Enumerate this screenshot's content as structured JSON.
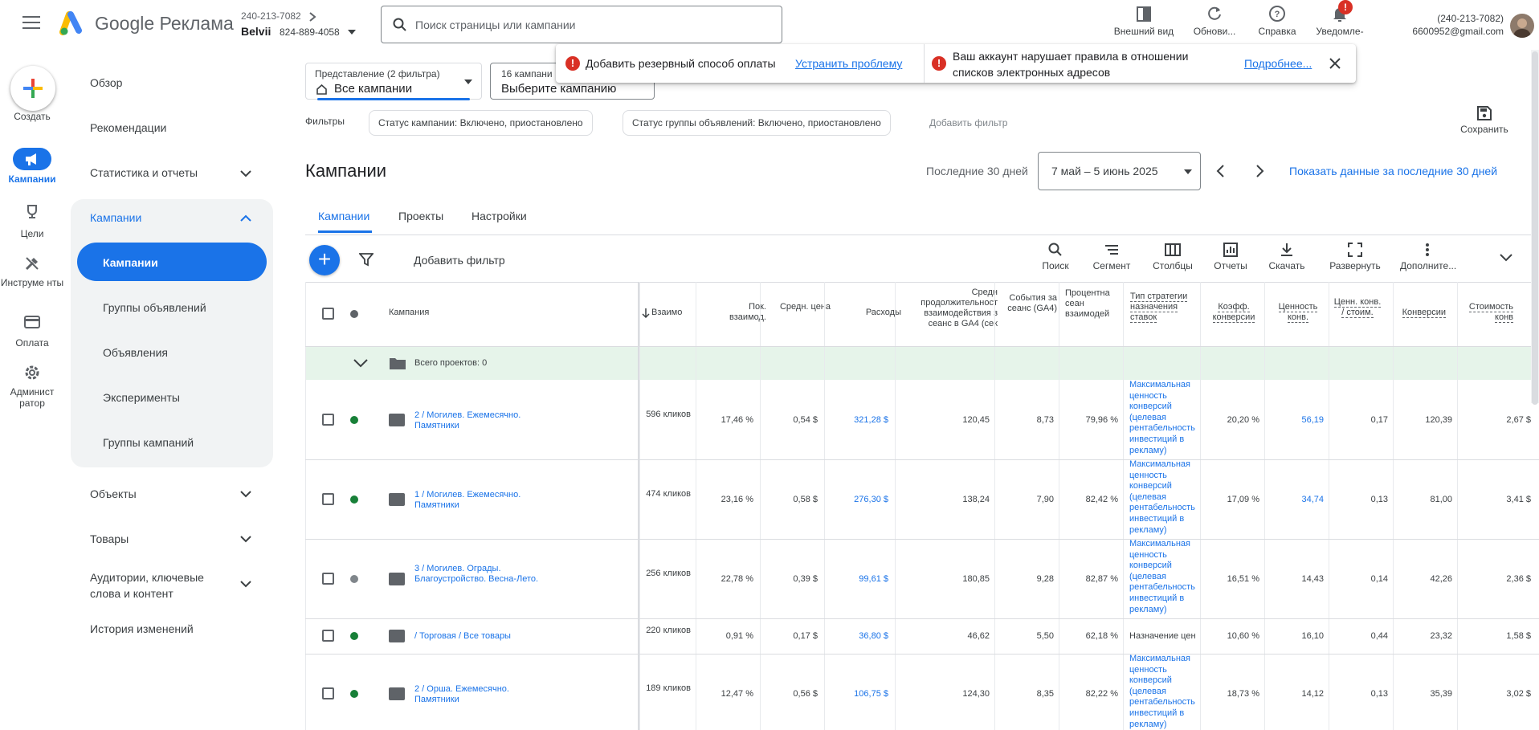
{
  "app": {
    "brand": "Google Реклама",
    "account_id": "240-213-7082",
    "account_name": "Belvii",
    "account_number": "824-889-4058",
    "search_placeholder": "Поиск страницы или кампании"
  },
  "topbar": {
    "items": [
      {
        "label": "Внешний вид",
        "icon": "appearance-icon"
      },
      {
        "label": "Обнови...",
        "icon": "refresh-icon"
      },
      {
        "label": "Справка",
        "icon": "help-icon"
      },
      {
        "label": "Уведомле- ния",
        "icon": "bell-icon"
      }
    ],
    "notification_count": "!",
    "user_phone": "(240-213-7082)",
    "user_email": "6600952@gmail.com"
  },
  "rail": {
    "create_label": "Создать",
    "items": [
      {
        "label": "Кампании",
        "icon": "megaphone-icon"
      },
      {
        "label": "Цели",
        "icon": "trophy-icon"
      },
      {
        "label": "Инструме нты",
        "icon": "tools-icon"
      },
      {
        "label": "Оплата",
        "icon": "card-icon"
      },
      {
        "label": "Админист ратор",
        "icon": "gear-icon"
      }
    ]
  },
  "nav": {
    "overview": "Обзор",
    "recommendations": "Рекомендации",
    "stats": "Статистика и отчеты",
    "campaigns_group": "Кампании",
    "campaigns": "Кампании",
    "ad_groups": "Группы объявлений",
    "ads": "Объявления",
    "experiments": "Эксперименты",
    "campaign_groups": "Группы кампаний",
    "assets": "Объекты",
    "products": "Товары",
    "audiences": "Аудитории, ключевые слова и контент",
    "change_history": "История изменений"
  },
  "view": {
    "label": "Представление (2 фильтра)",
    "value": "Все кампании",
    "campaign_count": "16 кампани",
    "campaign_select": "Выберите кампанию"
  },
  "alerts": {
    "payment_text": "Добавить резервный способ оплаты",
    "payment_link": "Устранить проблему",
    "policy_text": "Ваш аккаунт нарушает правила в отношении списков электронных адресов",
    "policy_link": "Подробнее..."
  },
  "filters": {
    "label": "Фильтры",
    "chip1": "Статус кампании: Включено, приостановлено",
    "chip2": "Статус группы объявлений: Включено, приостановлено",
    "add": "Добавить фильтр",
    "save": "Сохранить"
  },
  "page": {
    "title": "Кампании",
    "date_hint": "Последние 30 дней",
    "date_range": "7 май – 5 июнь 2025",
    "show_last_30": "Показать данные за последние 30 дней"
  },
  "tabs": [
    "Кампании",
    "Проекты",
    "Настройки"
  ],
  "toolbar": {
    "add_filter": "Добавить фильтр",
    "tools": [
      "Поиск",
      "Сегмент",
      "Столбцы",
      "Отчеты",
      "Скачать",
      "Развернуть",
      "Дополните..."
    ]
  },
  "table": {
    "headers": {
      "campaign": "Кампания",
      "interactions": "Взаимо",
      "interaction_rate": "Пок. взаимод.",
      "avg_cost": "Средн. цена",
      "cost": "Расходы",
      "avg_session": "Средн продолжительност взаимодействия з сеанс в GA4 (сек",
      "events_per_session": "События за сеанс (GA4)",
      "engaged_pct": "Процентна сеан взаимодей",
      "bid_strategy": "Тип стратегии назначения ставок",
      "conv_rate": "Коэфф. конверсии",
      "conv_value": "Ценность конв.",
      "value_cost": "Ценн. конв. / стоим.",
      "conversions": "Конверсии",
      "cost_conv": "Стоимость конв"
    },
    "total_row": "Всего проектов: 0",
    "rows": [
      {
        "status": "enabled",
        "type": "search",
        "name": "2 / Могилев. Ежемесячно. Памятники",
        "interactions": "596 кликов",
        "interaction_rate": "17,46 %",
        "avg_cost": "0,54 $",
        "cost": "321,28 $",
        "avg_session": "120,45",
        "events": "8,73",
        "engaged": "79,96 %",
        "strategy": "Максимальная ценность конверсий (целевая рентабельность инвестиций в рекламу)",
        "conv_rate": "20,20 %",
        "conv_value": "56,19",
        "value_cost": "0,17",
        "conversions": "120,39",
        "cost_conv": "2,67 $"
      },
      {
        "status": "enabled",
        "type": "search",
        "name": "1 / Могилев. Ежемесячно. Памятники",
        "interactions": "474 кликов",
        "interaction_rate": "23,16 %",
        "avg_cost": "0,58 $",
        "cost": "276,30 $",
        "avg_session": "138,24",
        "events": "7,90",
        "engaged": "82,42 %",
        "strategy": "Максимальная ценность конверсий (целевая рентабельность инвестиций в рекламу)",
        "conv_rate": "17,09 %",
        "conv_value": "34,74",
        "value_cost": "0,13",
        "conversions": "81,00",
        "cost_conv": "3,41 $"
      },
      {
        "status": "paused",
        "type": "search",
        "name": "3 / Могилев. Ограды. Благоустройство. Весна-Лето.",
        "interactions": "256 кликов",
        "interaction_rate": "22,78 %",
        "avg_cost": "0,39 $",
        "cost": "99,61 $",
        "avg_session": "180,85",
        "events": "9,28",
        "engaged": "82,87 %",
        "strategy": "Максимальная ценность конверсий (целевая рентабельность инвестиций в рекламу)",
        "conv_rate": "16,51 %",
        "conv_value": "14,43",
        "value_cost": "0,14",
        "conversions": "42,26",
        "cost_conv": "2,36 $"
      },
      {
        "status": "enabled",
        "type": "shopping",
        "name": "/ Торговая / Все товары",
        "interactions": "220 кликов",
        "interaction_rate": "0,91 %",
        "avg_cost": "0,17 $",
        "cost": "36,80 $",
        "avg_session": "46,62",
        "events": "5,50",
        "engaged": "62,18 %",
        "strategy": "Назначение цен",
        "conv_rate": "10,60 %",
        "conv_value": "16,10",
        "value_cost": "0,44",
        "conversions": "23,32",
        "cost_conv": "1,58 $"
      },
      {
        "status": "enabled",
        "type": "search",
        "name": "2 / Орша. Ежемесячно. Памятники",
        "interactions": "189 кликов",
        "interaction_rate": "12,47 %",
        "avg_cost": "0,56 $",
        "cost": "106,75 $",
        "avg_session": "124,30",
        "events": "8,35",
        "engaged": "82,22 %",
        "strategy": "Максимальная ценность конверсий (целевая рентабельность инвестиций в рекламу)",
        "conv_rate": "18,73 %",
        "conv_value": "14,12",
        "value_cost": "0,13",
        "conversions": "35,39",
        "cost_conv": "3,02 $"
      }
    ]
  },
  "colors": {
    "accent": "#1a73e8",
    "enabled": "#188038",
    "paused": "#80868b",
    "error": "#d93025",
    "total_row": "#e6f4ea"
  }
}
